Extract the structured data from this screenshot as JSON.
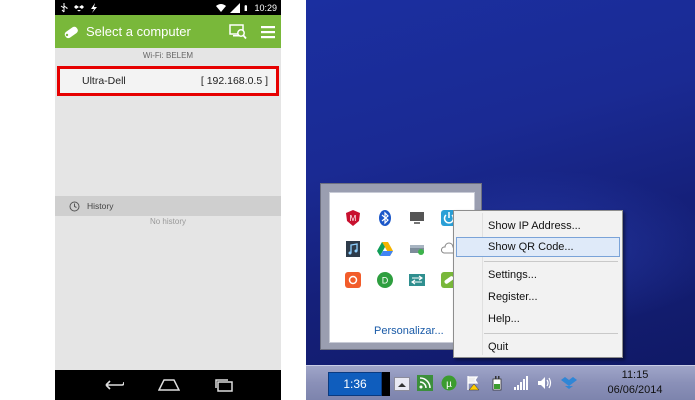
{
  "phone": {
    "status_time": "10:29",
    "app_title": "Select a computer",
    "wifi_label": "Wi-Fi: BELEM",
    "computer": {
      "name": "Ultra-Dell",
      "ip": "[ 192.168.0.5 ]"
    },
    "history_label": "History",
    "no_history": "No history",
    "colors": {
      "app_bar": "#79b83a",
      "highlight_border": "#e60000"
    },
    "icons": [
      "usb-icon",
      "dropbox-icon",
      "lightning-icon",
      "wifi-icon",
      "signal-icon",
      "battery-icon",
      "app-logo-icon",
      "search-computer-icon",
      "menu-icon",
      "clock-icon",
      "back-icon",
      "home-icon",
      "recents-icon"
    ]
  },
  "desktop": {
    "personalize": "Personalizar...",
    "menu": {
      "show_ip": "Show IP Address...",
      "show_qr": "Show QR Code...",
      "settings": "Settings...",
      "register": "Register...",
      "help": "Help...",
      "quit": "Quit"
    },
    "taskbar": {
      "app_time": "1:36",
      "clock_time": "11:15",
      "clock_date": "06/06/2014"
    },
    "colors": {
      "wallpaper": "#1a2a93",
      "menu_selected": "#dfeaf9"
    }
  }
}
